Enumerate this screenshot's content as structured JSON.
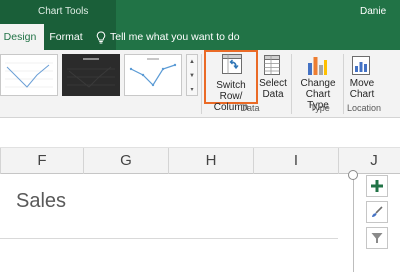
{
  "window": {
    "context_tab_group": "Chart Tools",
    "user": "Danie"
  },
  "tabs": [
    {
      "label": "Design",
      "active": true
    },
    {
      "label": "Format",
      "active": false
    }
  ],
  "tell_me": {
    "text": "Tell me what you want to do",
    "icon": "lightbulb-icon"
  },
  "ribbon": {
    "chart_styles_gallery": {
      "visible_thumbnails": 3,
      "scroll_icons": [
        "scroll-up-icon",
        "scroll-down-icon",
        "more-icon"
      ]
    },
    "groups": [
      {
        "name": "Data",
        "buttons": [
          {
            "label_line1": "Switch Row/",
            "label_line2": "Column",
            "icon": "switch-row-column-icon",
            "highlighted": true
          },
          {
            "label_line1": "Select",
            "label_line2": "Data",
            "icon": "select-data-icon"
          }
        ]
      },
      {
        "name": "Type",
        "buttons": [
          {
            "label_line1": "Change",
            "label_line2": "Chart Type",
            "icon": "change-chart-type-icon"
          }
        ]
      },
      {
        "name": "Location",
        "buttons": [
          {
            "label_line1": "Move",
            "label_line2": "Chart",
            "icon": "move-chart-icon"
          }
        ]
      }
    ]
  },
  "grid": {
    "columns": [
      "F",
      "G",
      "H",
      "I",
      "J"
    ]
  },
  "chart": {
    "title": "Sales",
    "side_buttons": [
      "chart-elements-plus-icon",
      "chart-styles-brush-icon",
      "chart-filters-funnel-icon"
    ]
  },
  "colors": {
    "excel_green": "#217346",
    "highlight_orange": "#ea6a26",
    "ribbon_bg": "#f3f3f3"
  }
}
